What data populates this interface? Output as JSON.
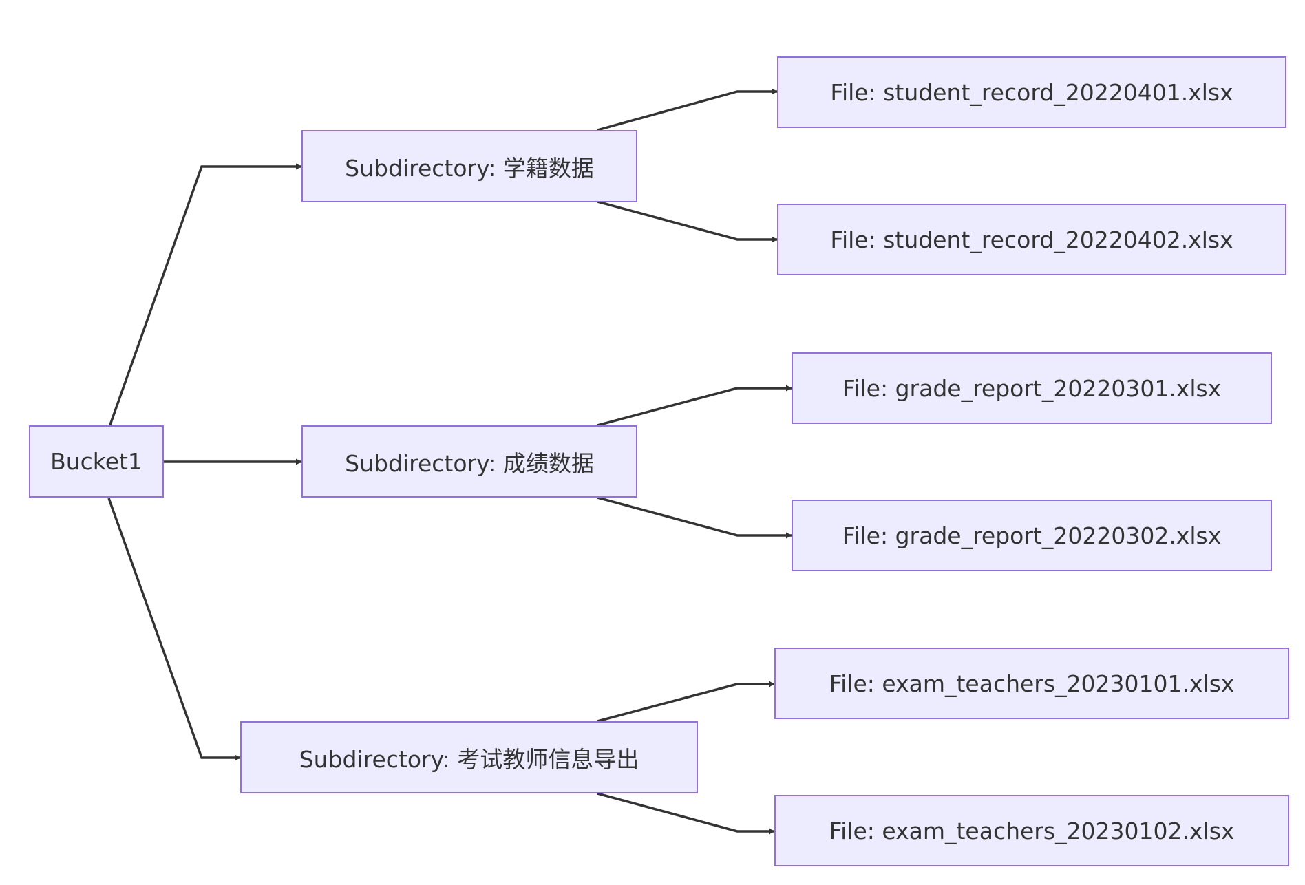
{
  "diagram": {
    "root": {
      "id": "bucket",
      "label": "Bucket1"
    },
    "subdirectories": [
      {
        "id": "sub1",
        "label": "Subdirectory: 学籍数据"
      },
      {
        "id": "sub2",
        "label": "Subdirectory: 成绩数据"
      },
      {
        "id": "sub3",
        "label": "Subdirectory: 考试教师信息导出"
      }
    ],
    "files": [
      {
        "id": "f1",
        "label": "File: student_record_20220401.xlsx"
      },
      {
        "id": "f2",
        "label": "File: student_record_20220402.xlsx"
      },
      {
        "id": "f3",
        "label": "File: grade_report_20220301.xlsx"
      },
      {
        "id": "f4",
        "label": "File: grade_report_20220302.xlsx"
      },
      {
        "id": "f5",
        "label": "File: exam_teachers_20230101.xlsx"
      },
      {
        "id": "f6",
        "label": "File: exam_teachers_20230102.xlsx"
      }
    ],
    "edges": [
      {
        "from": "bucket",
        "to": "sub1"
      },
      {
        "from": "bucket",
        "to": "sub2"
      },
      {
        "from": "bucket",
        "to": "sub3"
      },
      {
        "from": "sub1",
        "to": "f1"
      },
      {
        "from": "sub1",
        "to": "f2"
      },
      {
        "from": "sub2",
        "to": "f3"
      },
      {
        "from": "sub2",
        "to": "f4"
      },
      {
        "from": "sub3",
        "to": "f5"
      },
      {
        "from": "sub3",
        "to": "f6"
      }
    ],
    "colors": {
      "node_fill": "#ececfe",
      "node_border": "#9370db",
      "edge": "#333333",
      "text": "#333333"
    }
  }
}
